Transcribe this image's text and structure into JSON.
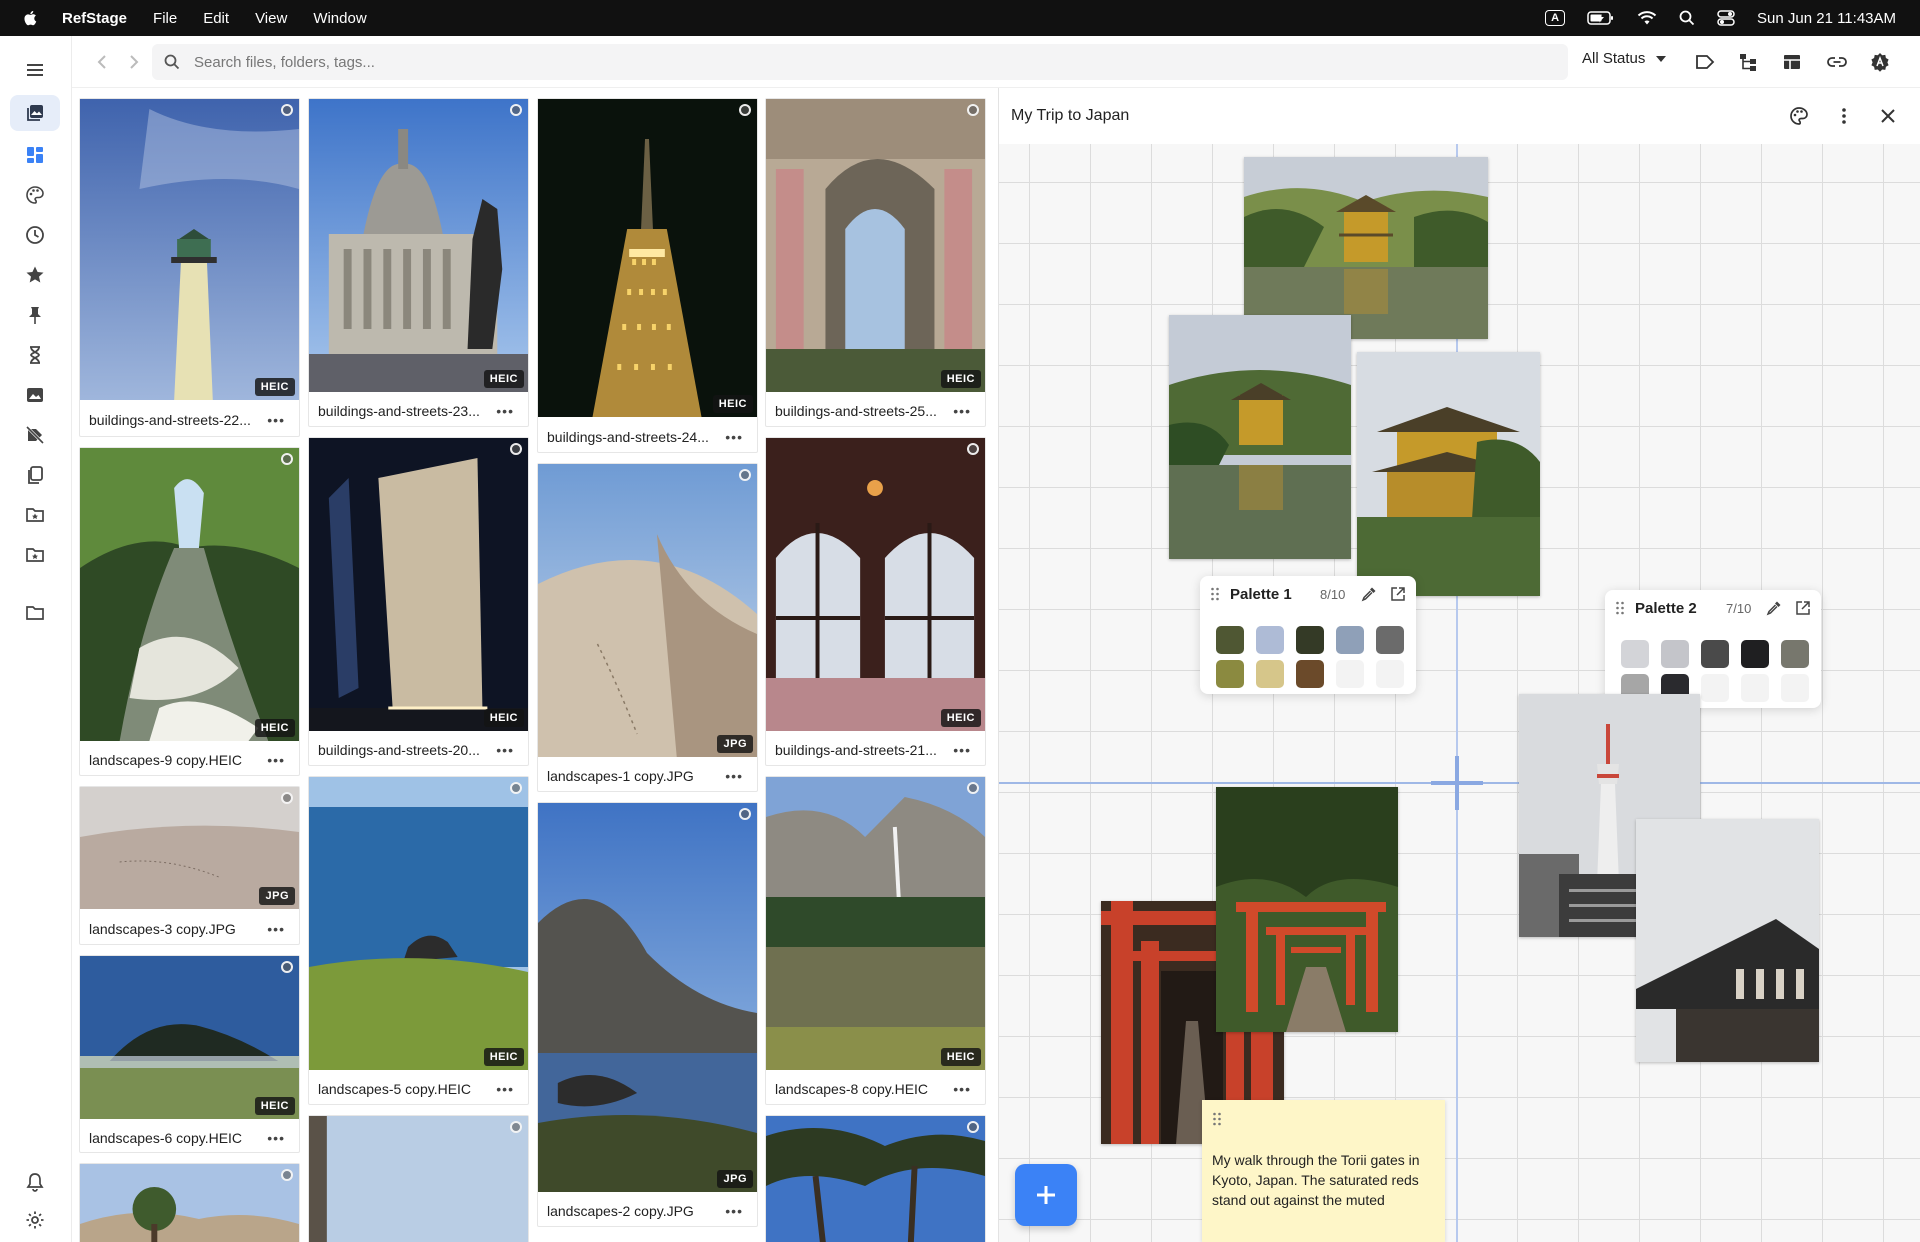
{
  "menubar": {
    "app_name": "RefStage",
    "menus": [
      "File",
      "Edit",
      "View",
      "Window"
    ],
    "clock": "Sun Jun 21  11:43AM",
    "input_badge": "A"
  },
  "toolbar": {
    "search_placeholder": "Search files, folders, tags...",
    "status_filter": "All Status"
  },
  "grid": {
    "items": [
      {
        "caption": "buildings-and-streets-22...",
        "badge": "HEIC"
      },
      {
        "caption": "buildings-and-streets-23...",
        "badge": "HEIC"
      },
      {
        "caption": "buildings-and-streets-24...",
        "badge": "HEIC"
      },
      {
        "caption": "buildings-and-streets-25...",
        "badge": "HEIC"
      },
      {
        "caption": "landscapes-9 copy.HEIC",
        "badge": "HEIC"
      },
      {
        "caption": "buildings-and-streets-20...",
        "badge": "HEIC"
      },
      {
        "caption": "landscapes-1 copy.JPG",
        "badge": "JPG"
      },
      {
        "caption": "buildings-and-streets-21...",
        "badge": "HEIC"
      },
      {
        "caption": "landscapes-3 copy.JPG",
        "badge": "JPG"
      },
      {
        "caption": "landscapes-5 copy.HEIC",
        "badge": "HEIC"
      },
      {
        "caption": "landscapes-2 copy.JPG",
        "badge": "JPG"
      },
      {
        "caption": "landscapes-8 copy.HEIC",
        "badge": "HEIC"
      },
      {
        "caption": "landscapes-6 copy.HEIC",
        "badge": "HEIC"
      }
    ],
    "more_glyph": "•••"
  },
  "panel": {
    "title": "My Trip to Japan",
    "palette1": {
      "name": "Palette 1",
      "count": "8/10",
      "colors": [
        "#4f5733",
        "#aebbd6",
        "#343a26",
        "#8fa0b8",
        "#6b6b6b",
        "#8b8a40",
        "#d6c68a",
        "#6b4a2a"
      ]
    },
    "palette2": {
      "name": "Palette 2",
      "count": "7/10",
      "colors": [
        "#d3d4d8",
        "#c4c5ca",
        "#4a4a4a",
        "#1f1f21",
        "#77776d",
        "#a6a6a6",
        "#2a2a2e"
      ]
    },
    "note": "My walk through the Torii gates in Kyoto, Japan. The saturated reds stand out against the muted"
  }
}
